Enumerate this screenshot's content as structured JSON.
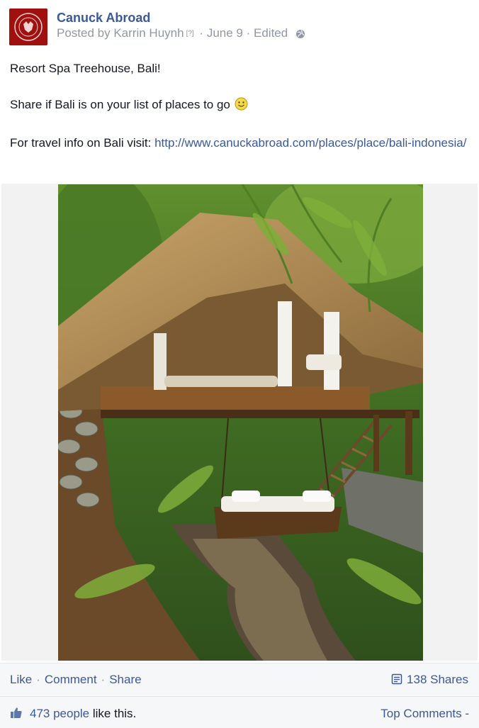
{
  "post": {
    "page_name": "Canuck Abroad",
    "posted_by_prefix": "Posted by",
    "author": "Karrin Huynh",
    "help_marker": "[?]",
    "date": "June 9",
    "edited": "Edited",
    "lines": {
      "title": "Resort Spa Treehouse, Bali!",
      "share_text": "Share if Bali is on your list of places to go",
      "travel_prefix": "For travel info on Bali visit:",
      "travel_link": "http://www.canuckabroad.com/places/place/bali-indonesia/"
    },
    "icons": {
      "privacy": "globe-icon",
      "emoji": "smiley-icon",
      "logo": "canuck-abroad-logo"
    }
  },
  "actions": {
    "like": "Like",
    "comment": "Comment",
    "share": "Share",
    "shares_count": "138 Shares",
    "separator": "·"
  },
  "likes_bar": {
    "count": "473 people",
    "suffix": "like this.",
    "top_comments": "Top Comments -"
  },
  "colors": {
    "link": "#3b5998",
    "meta": "#9197a3",
    "logo_bg": "#a0100f"
  }
}
